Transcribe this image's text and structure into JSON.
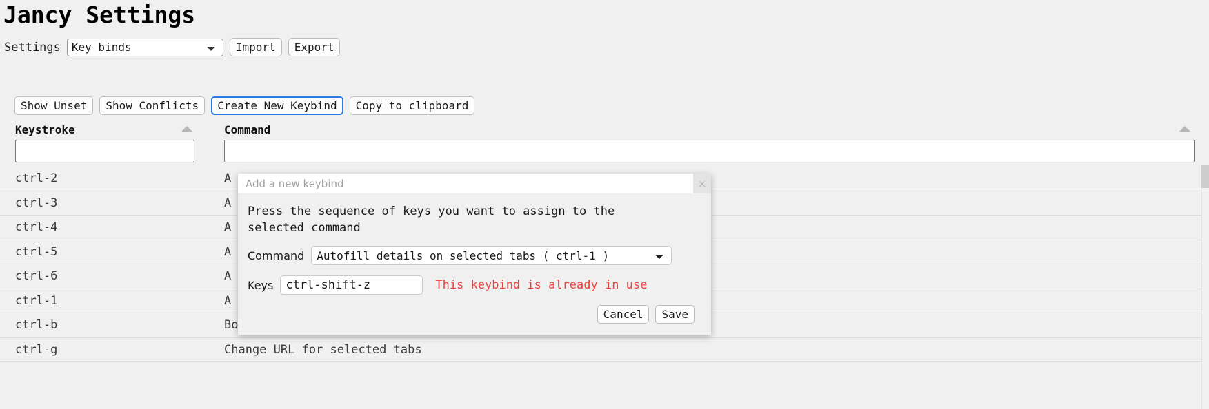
{
  "page_title": "Jancy Settings",
  "settings_bar": {
    "label": "Settings",
    "selected": "Key binds",
    "options": [
      "Key binds"
    ],
    "import_label": "Import",
    "export_label": "Export"
  },
  "actions": {
    "show_unset": "Show Unset",
    "show_conflicts": "Show Conflicts",
    "create_new_keybind": "Create New Keybind",
    "copy_to_clipboard": "Copy to clipboard",
    "focus_color": "#2a7ae2"
  },
  "table": {
    "columns": [
      {
        "key": "keystroke",
        "label": "Keystroke",
        "sort": "asc"
      },
      {
        "key": "command",
        "label": "Command",
        "sort": "asc"
      }
    ],
    "filters": {
      "keystroke_value": "",
      "command_value": ""
    },
    "rows": [
      {
        "keystroke": "ctrl-2",
        "command": "A"
      },
      {
        "keystroke": "ctrl-3",
        "command": "A"
      },
      {
        "keystroke": "ctrl-4",
        "command": "A"
      },
      {
        "keystroke": "ctrl-5",
        "command": "A"
      },
      {
        "keystroke": "ctrl-6",
        "command": "A"
      },
      {
        "keystroke": "ctrl-1",
        "command": "A"
      },
      {
        "keystroke": "ctrl-b",
        "command": "Bookmark page"
      },
      {
        "keystroke": "ctrl-g",
        "command": "Change URL for selected tabs"
      }
    ]
  },
  "dialog": {
    "title": "Add a new keybind",
    "close_icon": "×",
    "instruction": "Press the sequence of keys you want to assign to the selected command",
    "command_label": "Command",
    "command_selected": "Autofill details on selected tabs     ( ctrl-1 )",
    "command_options": [
      "Autofill details on selected tabs     ( ctrl-1 )"
    ],
    "keys_label": "Keys",
    "keys_value": "ctrl-shift-z",
    "error_message": "This keybind is already in use",
    "error_color": "#f0403c",
    "cancel_label": "Cancel",
    "save_label": "Save"
  }
}
